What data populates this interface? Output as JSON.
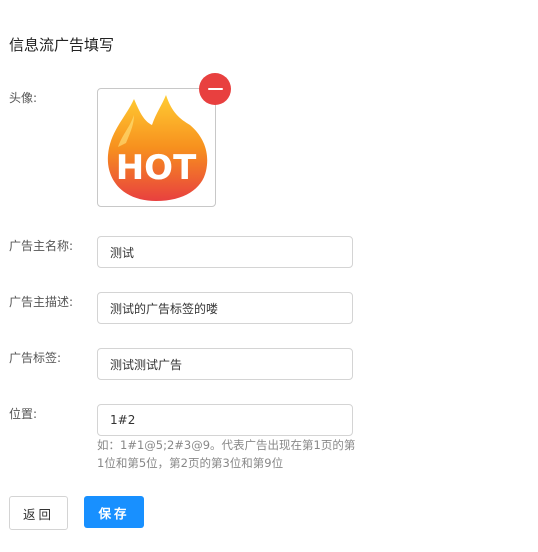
{
  "page_title": "信息流广告填写",
  "avatar": {
    "label": "头像:",
    "image_text": "HOT",
    "remove_icon": "minus-circle-icon"
  },
  "fields": {
    "advertiser_name": {
      "label": "广告主名称:",
      "value": "测试"
    },
    "advertiser_desc": {
      "label": "广告主描述:",
      "value": "测试的广告标签的喽"
    },
    "ad_tags": {
      "label": "广告标签:",
      "value": "测试测试广告"
    },
    "position": {
      "label": "位置:",
      "value": "1#2",
      "hint": "如：1#1@5;2#3@9。代表广告出现在第1页的第1位和第5位，第2页的第3位和第9位"
    }
  },
  "buttons": {
    "back": "返回",
    "save": "保存"
  },
  "colors": {
    "primary": "#1890ff",
    "remove": "#e8403f"
  }
}
